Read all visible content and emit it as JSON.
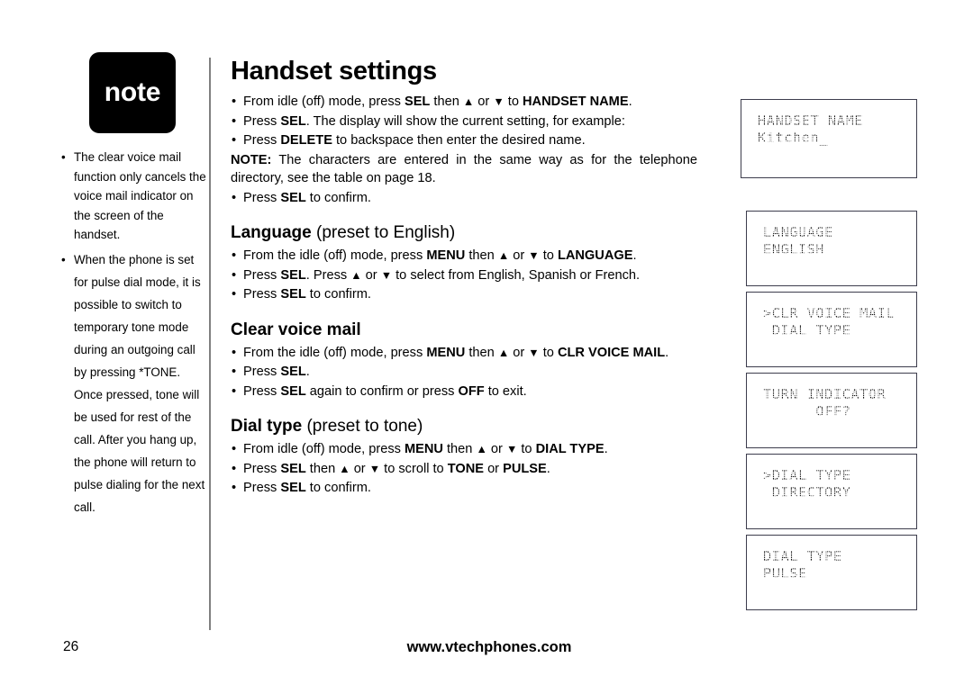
{
  "note_sidebar": {
    "badge_label": "note",
    "items": [
      "The clear voice mail function only cancels the voice mail indicator on the screen of the handset.",
      "When the phone is set for pulse dial mode, it is possible to switch to temporary tone mode during an outgoing call by pressing *TONE. Once pressed, tone will be used for rest of the call. After you hang up, the phone will return to pulse dialing for the next call."
    ],
    "bullet_glyph": "•"
  },
  "main": {
    "title": "Handset settings",
    "bullet_glyph": "•",
    "handset_name": {
      "steps": [
        "From idle (off) mode, press SEL then ▲ or ▼ to HANDSET NAME.",
        "Press SEL. The display will show the current setting, for example:",
        "Press DELETE to backspace then enter the desired name.",
        "Press SEL to confirm."
      ],
      "note_label": "NOTE:",
      "note_text": "The characters are entered in the same way as for the telephone directory, see the table on page 18."
    },
    "language": {
      "heading_bold": "Language",
      "heading_light": "(preset to English)",
      "steps": [
        "From the idle (off) mode, press MENU then ▲ or ▼ to LANGUAGE.",
        "Press SEL. Press ▲ or ▼ to select from English, Spanish or French.",
        "Press SEL to confirm."
      ]
    },
    "clear_voice_mail": {
      "heading_bold": "Clear voice mail",
      "steps": [
        "From the idle (off) mode, press MENU then ▲ or ▼ to CLR VOICE MAIL.",
        "Press SEL.",
        "Press SEL again to confirm or press OFF to exit."
      ]
    },
    "dial_type": {
      "heading_bold": "Dial type",
      "heading_light": "(preset to tone)",
      "steps": [
        "From idle (off) mode, press MENU then ▲ or ▼ to DIAL TYPE.",
        "Press SEL then ▲ or ▼ to scroll to TONE or PULSE.",
        "Press SEL to confirm."
      ]
    }
  },
  "lcd_screens": [
    {
      "id": "lcd-0",
      "line1": "HANDSET NAME",
      "line2": "Kitchen_"
    },
    {
      "id": "lcd-1",
      "line1": "LANGUAGE",
      "line2": "ENGLISH"
    },
    {
      "id": "lcd-2",
      "line1": ">CLR VOICE MAIL",
      "line2": " DIAL TYPE"
    },
    {
      "id": "lcd-3",
      "line1": "TURN INDICATOR",
      "line2": "      OFF?"
    },
    {
      "id": "lcd-4",
      "line1": ">DIAL TYPE",
      "line2": " DIRECTORY"
    },
    {
      "id": "lcd-5",
      "line1": "DIAL TYPE",
      "line2": "PULSE"
    }
  ],
  "footer": {
    "page_number": "26",
    "website": "www.vtechphones.com"
  }
}
